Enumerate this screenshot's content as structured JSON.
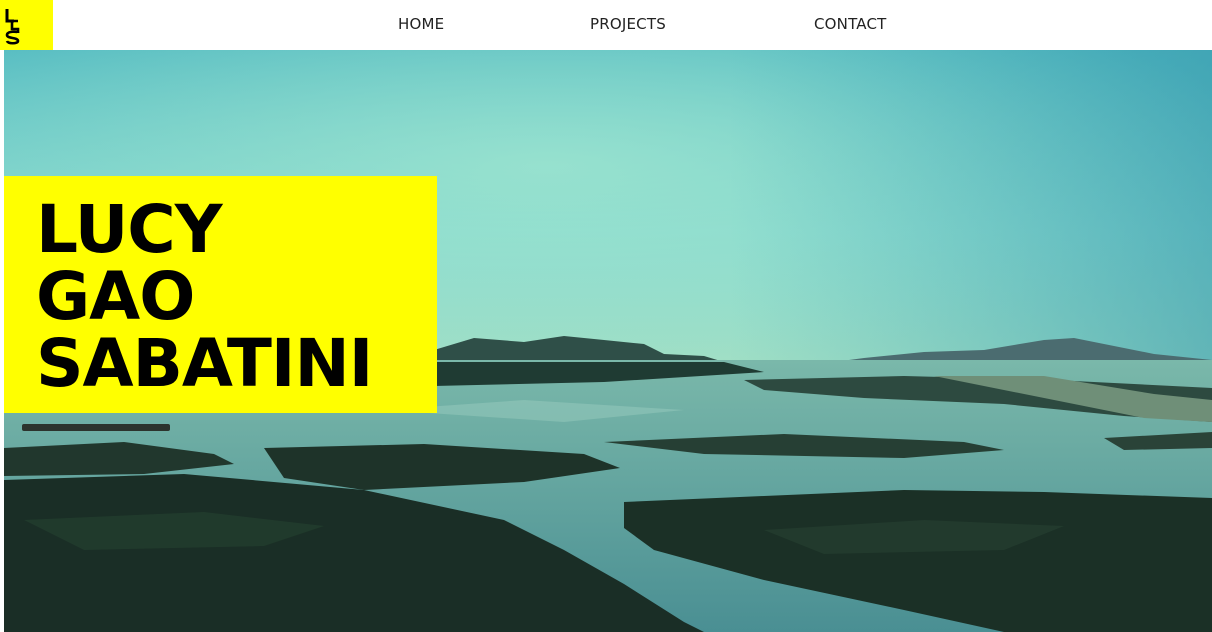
{
  "nav": {
    "items": [
      {
        "label": "HOME"
      },
      {
        "label": "PROJECTS"
      },
      {
        "label": "CONTACT"
      }
    ]
  },
  "hero": {
    "name_lines": [
      "LUCY",
      "GAO",
      "SABATINI"
    ]
  },
  "colors": {
    "accent": "#ffff00",
    "nav_text": "#222222",
    "name_text": "#000000"
  },
  "icons": {
    "logo": "lgs-monogram-logo"
  }
}
